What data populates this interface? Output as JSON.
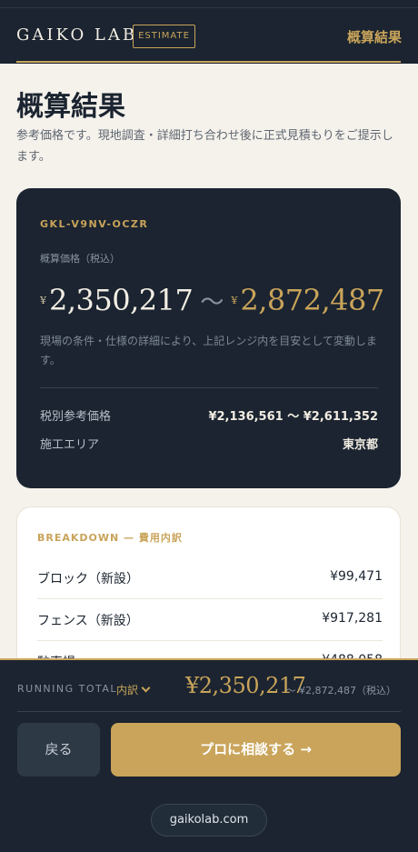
{
  "header": {
    "brand": "GAIKO LAB",
    "badge": "ESTIMATE",
    "right_label": "概算結果"
  },
  "page": {
    "title": "概算結果",
    "subtitle": "参考価格です。現地調査・詳細打ち合わせ後に正式見積もりをご提示します。"
  },
  "estimate": {
    "reference_code": "GKL-V9NV-OCZR",
    "label": "概算価格（税込）",
    "currency_symbol": "¥",
    "low": "2,350,217",
    "separator": "〜",
    "high": "2,872,487",
    "note": "現場の条件・仕様の詳細により、上記レンジ内を目安として変動します。",
    "rows": [
      {
        "key": "税別参考価格",
        "value": "¥2,136,561 〜 ¥2,611,352"
      },
      {
        "key": "施工エリア",
        "value": "東京都"
      }
    ]
  },
  "breakdown": {
    "title": "BREAKDOWN — 費用内訳",
    "items": [
      {
        "name": "ブロック（新設）",
        "price": "¥99,471"
      },
      {
        "name": "フェンス（新設）",
        "price": "¥917,281"
      },
      {
        "name": "駐車場",
        "price": "¥488,058"
      }
    ]
  },
  "running_total": {
    "label": "RUNNING TOTAL",
    "toggle": "内訳",
    "amount": "¥2,350,217",
    "high": "〜 ¥2,872,487（税込）"
  },
  "actions": {
    "back": "戻る",
    "consult": "プロに相談する →"
  },
  "footer": {
    "url": "gaikolab.com"
  }
}
